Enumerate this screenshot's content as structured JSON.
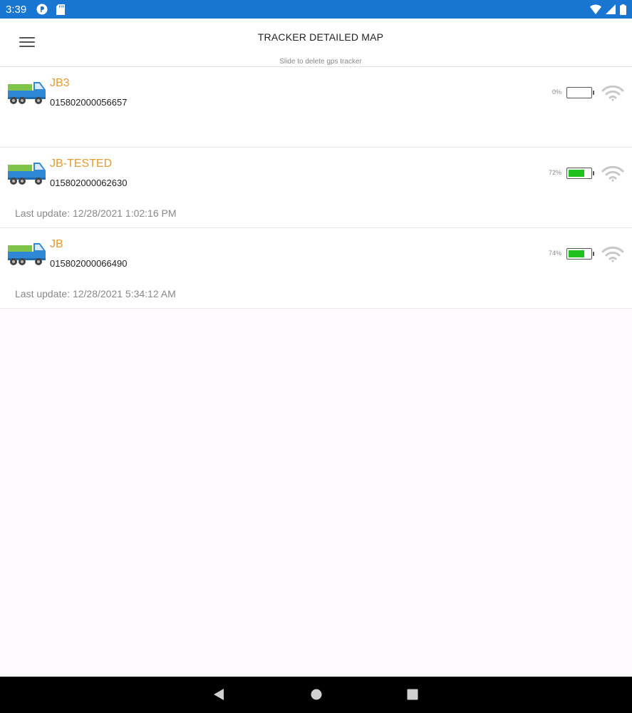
{
  "status_bar": {
    "time": "3:39",
    "color": "#1976d2",
    "left_icons": [
      "app-notification-icon",
      "sd-card-icon"
    ],
    "right_icons": [
      "wifi-icon",
      "cell-signal-icon",
      "battery-icon"
    ]
  },
  "app_bar": {
    "title": "TRACKER DETAILED MAP",
    "subtitle": "Slide to delete gps tracker"
  },
  "trackers": [
    {
      "name": "JB3",
      "id": "015802000056657",
      "last_update": "",
      "battery_percent": "0%",
      "battery_level": 0
    },
    {
      "name": "JB-TESTED",
      "id": "015802000062630",
      "last_update": "Last update: 12/28/2021 1:02:16 PM",
      "battery_percent": "72%",
      "battery_level": 0.72
    },
    {
      "name": "JB",
      "id": "015802000066490",
      "last_update": "Last update: 12/28/2021 5:34:12 AM",
      "battery_percent": "74%",
      "battery_level": 0.74
    }
  ],
  "colors": {
    "tracker_name": "#e69a2c",
    "battery_fill": "#1ec31e"
  },
  "nav_bar": {
    "buttons": [
      "back-icon",
      "home-icon",
      "recents-icon"
    ]
  }
}
